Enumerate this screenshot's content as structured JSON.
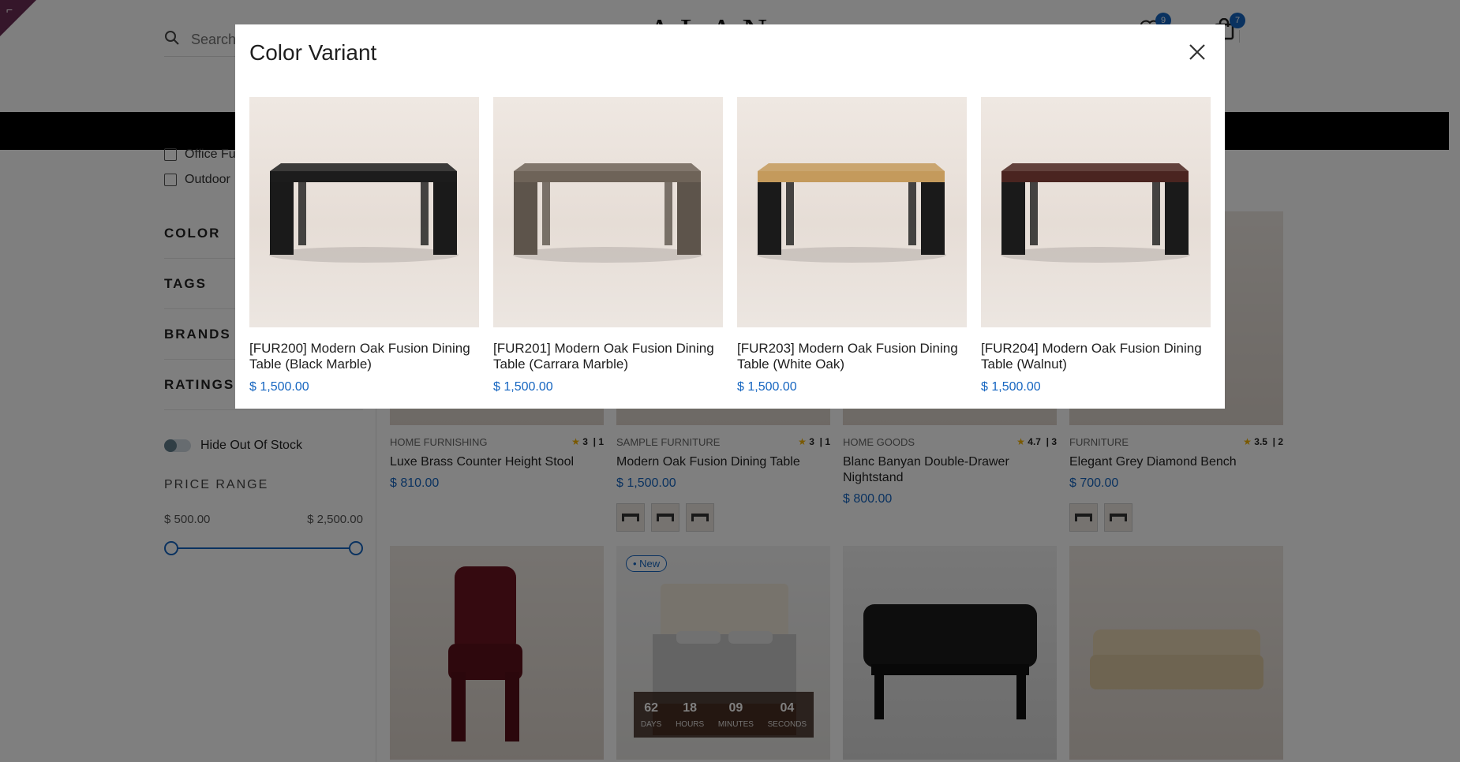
{
  "header": {
    "corner_mark": "⌐",
    "search_placeholder": "Search",
    "logo": "ALAN",
    "wishlist_count": "9",
    "cart_count": "7"
  },
  "sidebar": {
    "categories": [
      "Office Fu",
      "Outdoor"
    ],
    "filters": [
      "COLOR",
      "TAGS",
      "BRANDS",
      "RATINGS"
    ],
    "hide_out_of_stock": "Hide Out Of Stock",
    "price_range": {
      "title": "PRICE RANGE",
      "min": "$ 500.00",
      "max": "$ 2,500.00",
      "min_fraction": 0.0,
      "max_fraction": 1.0
    }
  },
  "products": [
    {
      "category": "HOME FURNISHING",
      "rating": "3",
      "reviews": "1",
      "name": "Luxe Brass Counter Height Stool",
      "price": "$ 810.00"
    },
    {
      "category": "SAMPLE FURNITURE",
      "rating": "3",
      "reviews": "1",
      "name": "Modern Oak Fusion Dining Table",
      "price": "$ 1,500.00"
    },
    {
      "category": "HOME GOODS",
      "rating": "4.7",
      "reviews": "3",
      "name": "Blanc Banyan Double-Drawer Nightstand",
      "price": "$ 800.00"
    },
    {
      "category": "FURNITURE",
      "rating": "3.5",
      "reviews": "2",
      "name": "Elegant Grey Diamond Bench",
      "price": "$ 700.00"
    }
  ],
  "new_badge": "• New",
  "countdown": [
    {
      "value": "62",
      "label": "DAYS"
    },
    {
      "value": "18",
      "label": "HOURS"
    },
    {
      "value": "09",
      "label": "MINUTES"
    },
    {
      "value": "04",
      "label": "SECONDS"
    }
  ],
  "modal": {
    "title": "Color Variant",
    "variants": [
      {
        "name": "[FUR200] Modern Oak Fusion Dining Table (Black Marble)",
        "price": "$ 1,500.00",
        "top_color": "#1c1c1c",
        "leg_color": "#1a1a1a"
      },
      {
        "name": "[FUR201] Modern Oak Fusion Dining Table (Carrara Marble)",
        "price": "$ 1,500.00",
        "top_color": "#6e6358",
        "leg_color": "#5d544b"
      },
      {
        "name": "[FUR203] Modern Oak Fusion Dining Table (White Oak)",
        "price": "$ 1,500.00",
        "top_color": "#c49a5c",
        "leg_color": "#1a1a1a"
      },
      {
        "name": "[FUR204] Modern Oak Fusion Dining Table (Walnut)",
        "price": "$ 1,500.00",
        "top_color": "#4a2420",
        "leg_color": "#1a1a1a"
      }
    ]
  },
  "colors": {
    "accent": "#1565c0",
    "overlay": "rgba(0,0,0,0.5)",
    "brand_corner": "#6b2c55"
  }
}
